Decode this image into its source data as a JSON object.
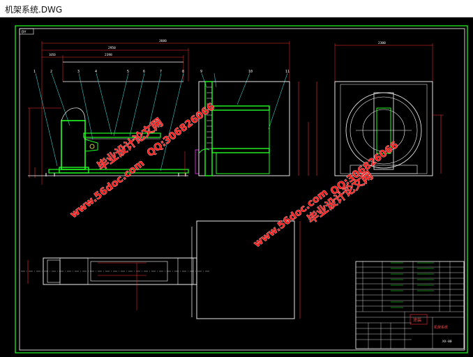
{
  "window": {
    "title": "机架系统.DWG"
  },
  "drawing": {
    "frame_tag": "DY",
    "dimensions": {
      "overall_length": "3600",
      "sub_length": "2950",
      "part_length_a": "2398",
      "left_offset": "1050",
      "right_width": "2300"
    },
    "balloons": [
      "1",
      "2",
      "3",
      "4",
      "5",
      "6",
      "7",
      "8",
      "9",
      "10",
      "11"
    ],
    "title_block": {
      "stamp": "涂装",
      "drawing_no": "XX-00",
      "name_label": "机架系统"
    }
  },
  "watermarks": {
    "site_1": "www.56doc.com",
    "name_1": "毕业设计论文网",
    "qq_1": "QQ:306826066",
    "site_2": "www.56doc.com",
    "name_2": "毕业设计论文网",
    "qq_2": "QQ:306826066"
  },
  "colors": {
    "line": "#ffffff",
    "part": "#22ff22",
    "dim": "#ff3333",
    "leader": "#33cccc",
    "frame": "#22ff22",
    "magenta": "#ff33ff",
    "watermark": "#ff1a1a"
  }
}
